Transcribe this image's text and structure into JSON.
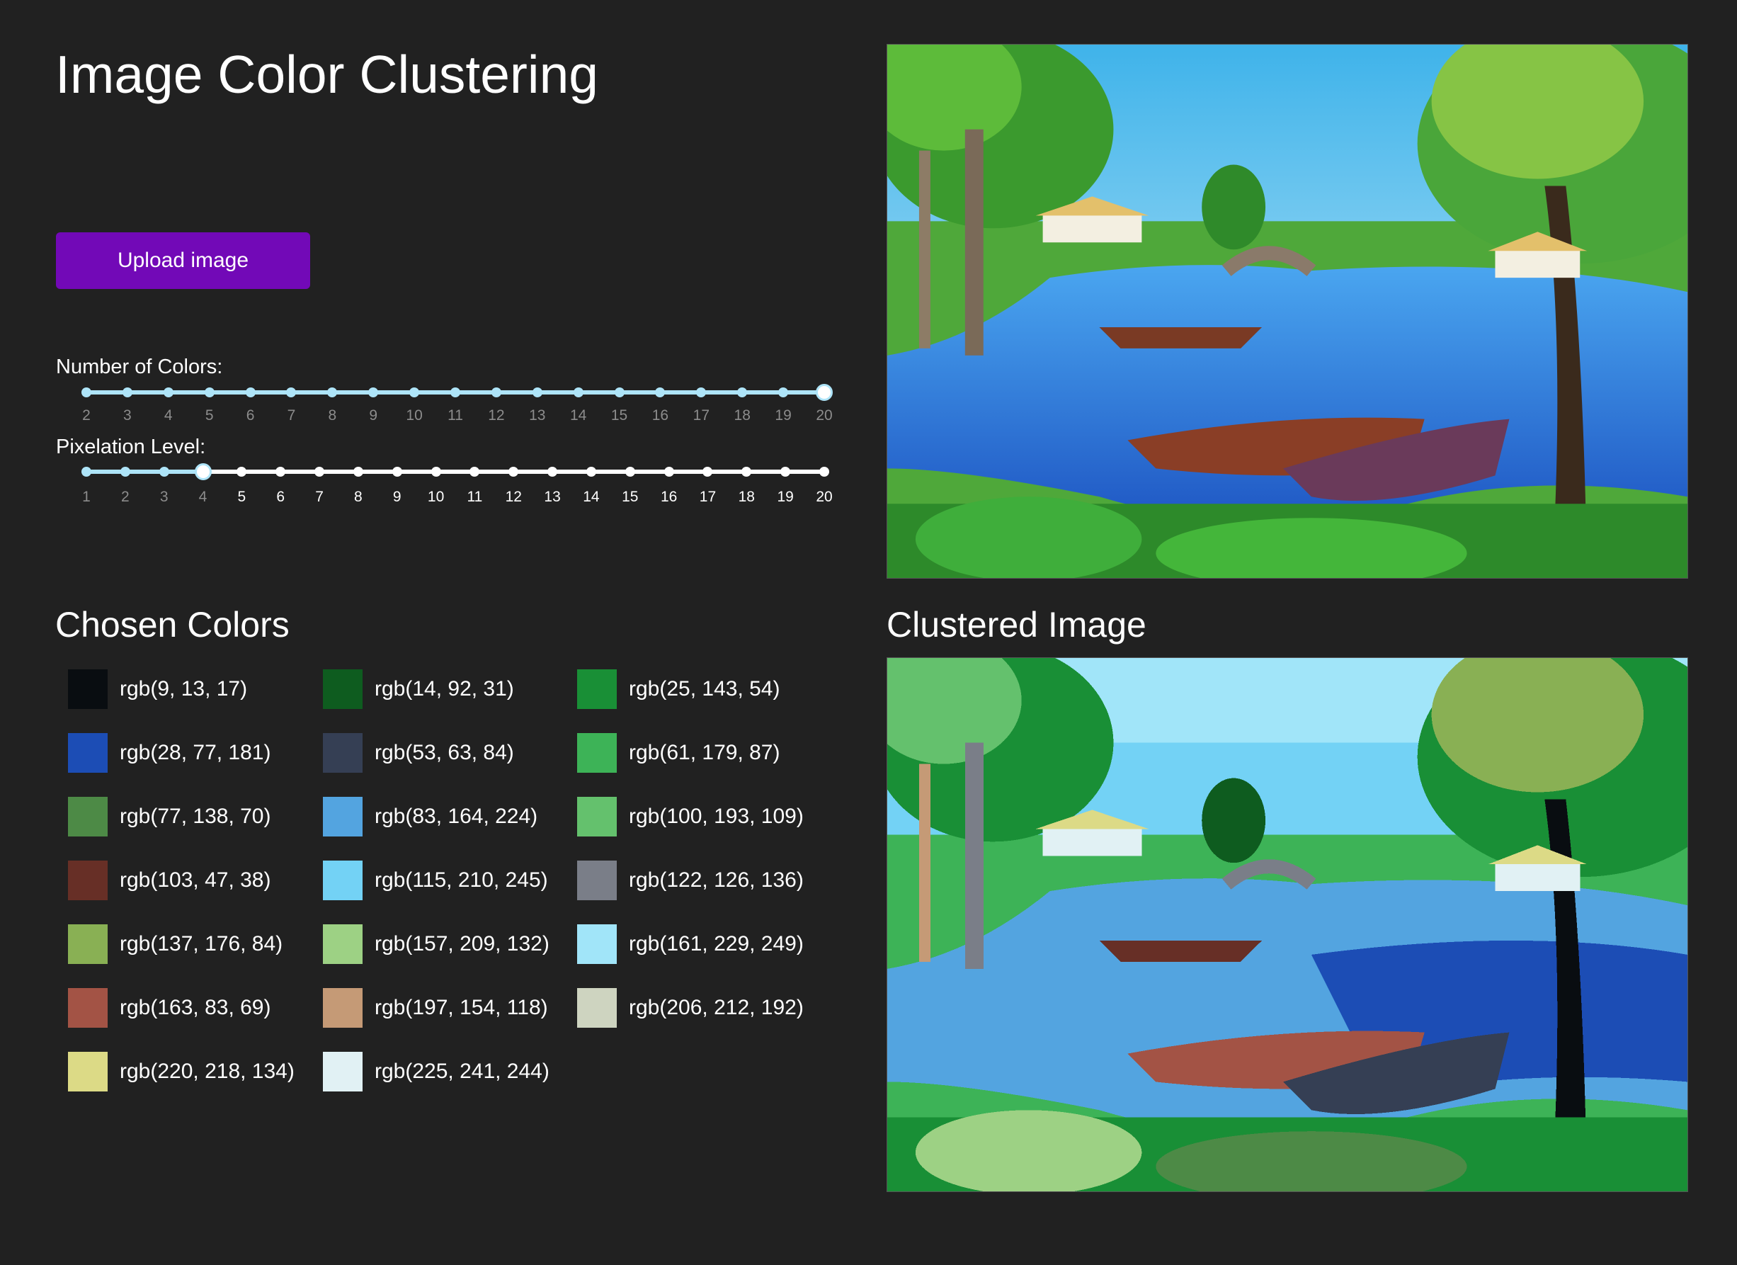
{
  "header": {
    "title": "Image Color Clustering"
  },
  "upload": {
    "label": "Upload image"
  },
  "sliders": {
    "colors": {
      "label": "Number of Colors:",
      "min": 2,
      "max": 20,
      "value": 20,
      "ticks": [
        "2",
        "3",
        "4",
        "5",
        "6",
        "7",
        "8",
        "9",
        "10",
        "11",
        "12",
        "13",
        "14",
        "15",
        "16",
        "17",
        "18",
        "19",
        "20"
      ]
    },
    "pixelation": {
      "label": "Pixelation Level:",
      "min": 1,
      "max": 20,
      "value": 4,
      "ticks": [
        "1",
        "2",
        "3",
        "4",
        "5",
        "6",
        "7",
        "8",
        "9",
        "10",
        "11",
        "12",
        "13",
        "14",
        "15",
        "16",
        "17",
        "18",
        "19",
        "20"
      ]
    }
  },
  "chosen_colors": {
    "title": "Chosen Colors",
    "items": [
      {
        "label": "rgb(9, 13, 17)",
        "color": "#090d11"
      },
      {
        "label": "rgb(14, 92, 31)",
        "color": "#0e5c1f"
      },
      {
        "label": "rgb(25, 143, 54)",
        "color": "#198f36"
      },
      {
        "label": "rgb(28, 77, 181)",
        "color": "#1c4db5"
      },
      {
        "label": "rgb(53, 63, 84)",
        "color": "#353f54"
      },
      {
        "label": "rgb(61, 179, 87)",
        "color": "#3db357"
      },
      {
        "label": "rgb(77, 138, 70)",
        "color": "#4d8a46"
      },
      {
        "label": "rgb(83, 164, 224)",
        "color": "#53a4e0"
      },
      {
        "label": "rgb(100, 193, 109)",
        "color": "#64c16d"
      },
      {
        "label": "rgb(103, 47, 38)",
        "color": "#672f26"
      },
      {
        "label": "rgb(115, 210, 245)",
        "color": "#73d2f5"
      },
      {
        "label": "rgb(122, 126, 136)",
        "color": "#7a7e88"
      },
      {
        "label": "rgb(137, 176, 84)",
        "color": "#89b054"
      },
      {
        "label": "rgb(157, 209, 132)",
        "color": "#9dd184"
      },
      {
        "label": "rgb(161, 229, 249)",
        "color": "#a1e5f9"
      },
      {
        "label": "rgb(163, 83, 69)",
        "color": "#a35345"
      },
      {
        "label": "rgb(197, 154, 118)",
        "color": "#c59a76"
      },
      {
        "label": "rgb(206, 212, 192)",
        "color": "#ced4c0"
      },
      {
        "label": "rgb(220, 218, 134)",
        "color": "#dcda86"
      },
      {
        "label": "rgb(225, 241, 244)",
        "color": "#e1f1f4"
      }
    ]
  },
  "clustered": {
    "title": "Clustered Image"
  },
  "theme": {
    "background": "#212121",
    "accent": "#7209b7",
    "slider_fill": "#aee4f8"
  }
}
